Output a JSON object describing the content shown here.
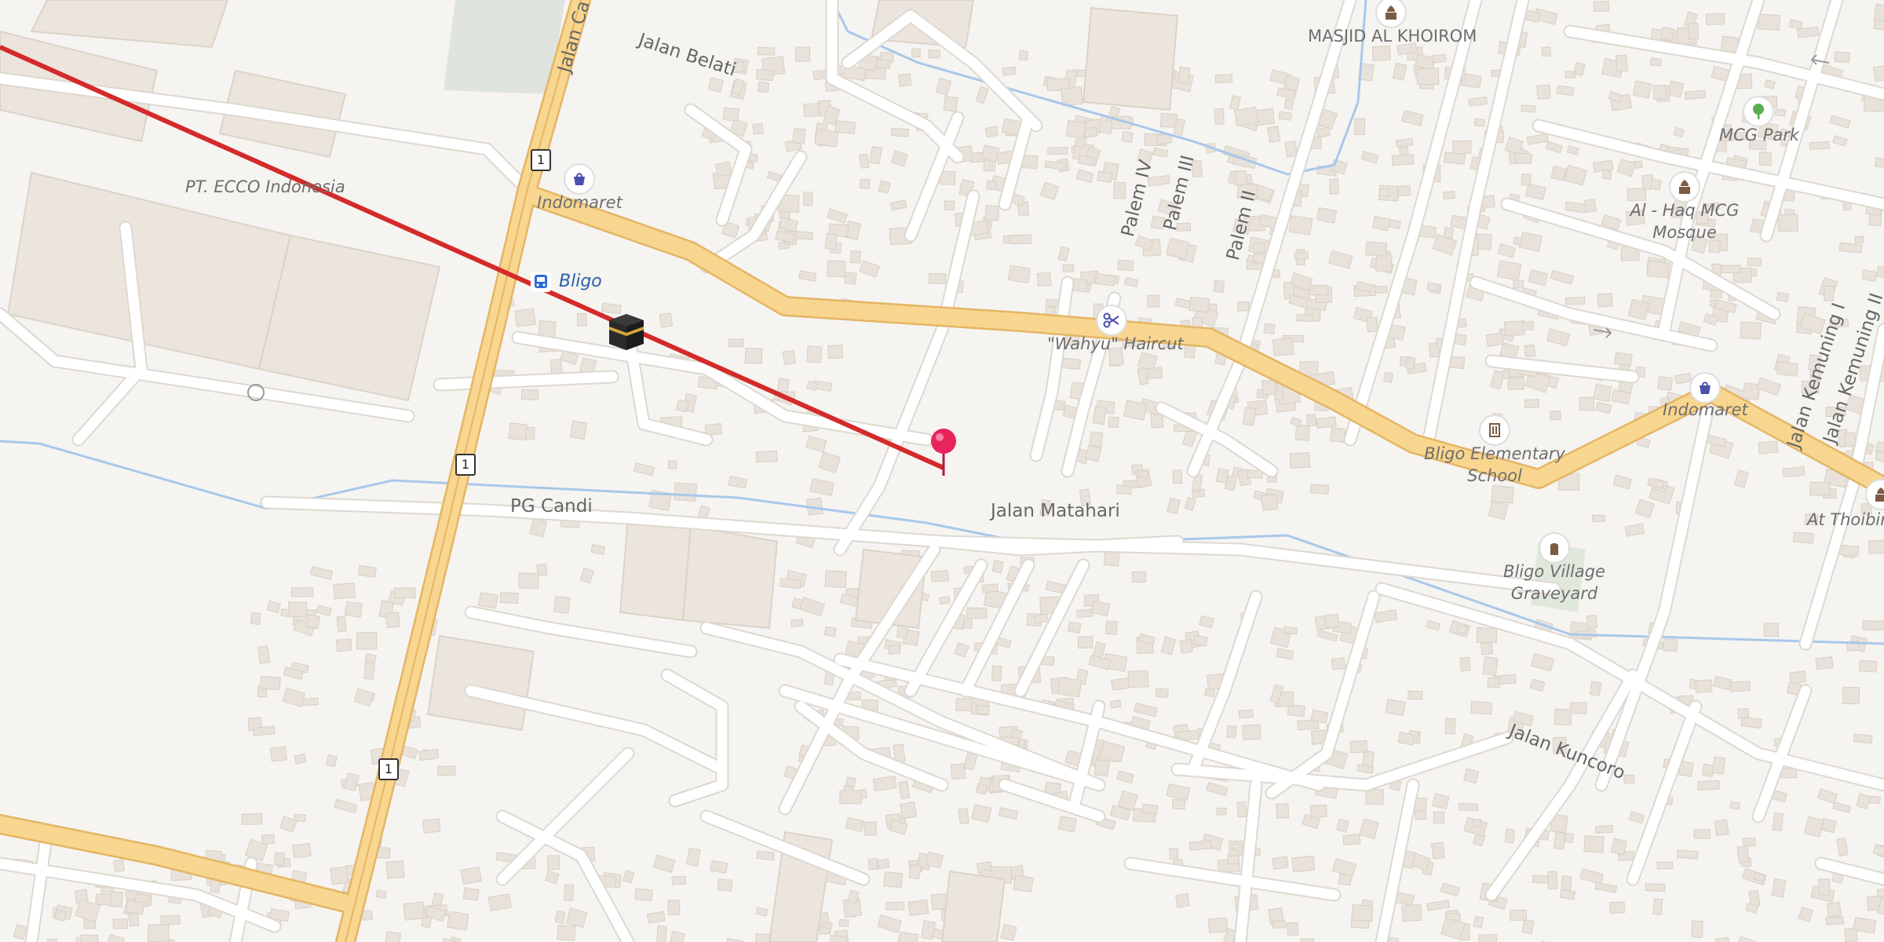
{
  "map": {
    "street_labels": {
      "jalan_belati": "Jalan Belati",
      "jalan_ca": "Jalan Ca",
      "pg_candi": "PG Candi",
      "jalan_matahari": "Jalan Matahari",
      "jalan_kuncoro": "Jalan Kuncoro",
      "palem_iv": "Palem IV",
      "palem_iii": "Palem III",
      "palem_ii": "Palem II",
      "jalan_kemuning_i": "Jalan Kemuning I",
      "jalan_kemuning_ii": "Jalan Kemuning II"
    },
    "road_shields": {
      "route_1": "1"
    },
    "transit": {
      "bligo": "Bligo"
    },
    "pois": {
      "masjid_al_khoirom": "MASJID AL KHOIROM",
      "pt_ecco": "PT. ECCO Indonesia",
      "indomaret_west": "Indomaret",
      "wahyu_haircut": "\"Wahyu\" Haircut",
      "mcg_park": "MCG Park",
      "al_haq_line1": "Al - Haq MCG",
      "al_haq_line2": "Mosque",
      "indomaret_east": "Indomaret",
      "bligo_school_line1": "Bligo Elementary",
      "bligo_school_line2": "School",
      "at_thoibin": "At Thoibin",
      "graveyard_line1": "Bligo Village",
      "graveyard_line2": "Graveyard"
    },
    "icons": {
      "shop": "shopping-bag-icon",
      "bus": "bus-stop-icon",
      "kaaba": "kaaba-qibla-icon",
      "pin": "location-pin-icon",
      "scissors": "scissors-icon",
      "mosque": "mosque-icon",
      "tree": "park-tree-icon",
      "school": "school-icon",
      "grave": "graveyard-icon"
    },
    "colors": {
      "background": "#f6f4f1",
      "building": "#e9e3dc",
      "building_edge": "#d8d0c6",
      "minor_road": "#ffffff",
      "road_casing": "#dedad4",
      "primary_road": "#f7d48a",
      "primary_casing": "#e5b868",
      "water": "#a8c8ea",
      "qibla_line": "#d42a2a",
      "pin": "#e8245a",
      "poi_blue": "#4b4fae",
      "park_green": "#5aad50"
    }
  }
}
